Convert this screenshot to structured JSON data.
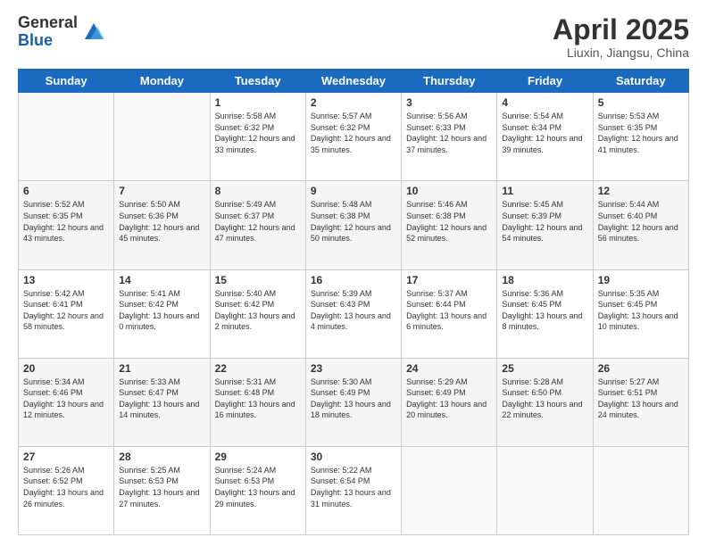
{
  "logo": {
    "general": "General",
    "blue": "Blue"
  },
  "header": {
    "title": "April 2025",
    "location": "Liuxin, Jiangsu, China"
  },
  "weekdays": [
    "Sunday",
    "Monday",
    "Tuesday",
    "Wednesday",
    "Thursday",
    "Friday",
    "Saturday"
  ],
  "weeks": [
    [
      {
        "day": "",
        "sunrise": "",
        "sunset": "",
        "daylight": ""
      },
      {
        "day": "",
        "sunrise": "",
        "sunset": "",
        "daylight": ""
      },
      {
        "day": "1",
        "sunrise": "Sunrise: 5:58 AM",
        "sunset": "Sunset: 6:32 PM",
        "daylight": "Daylight: 12 hours and 33 minutes."
      },
      {
        "day": "2",
        "sunrise": "Sunrise: 5:57 AM",
        "sunset": "Sunset: 6:32 PM",
        "daylight": "Daylight: 12 hours and 35 minutes."
      },
      {
        "day": "3",
        "sunrise": "Sunrise: 5:56 AM",
        "sunset": "Sunset: 6:33 PM",
        "daylight": "Daylight: 12 hours and 37 minutes."
      },
      {
        "day": "4",
        "sunrise": "Sunrise: 5:54 AM",
        "sunset": "Sunset: 6:34 PM",
        "daylight": "Daylight: 12 hours and 39 minutes."
      },
      {
        "day": "5",
        "sunrise": "Sunrise: 5:53 AM",
        "sunset": "Sunset: 6:35 PM",
        "daylight": "Daylight: 12 hours and 41 minutes."
      }
    ],
    [
      {
        "day": "6",
        "sunrise": "Sunrise: 5:52 AM",
        "sunset": "Sunset: 6:35 PM",
        "daylight": "Daylight: 12 hours and 43 minutes."
      },
      {
        "day": "7",
        "sunrise": "Sunrise: 5:50 AM",
        "sunset": "Sunset: 6:36 PM",
        "daylight": "Daylight: 12 hours and 45 minutes."
      },
      {
        "day": "8",
        "sunrise": "Sunrise: 5:49 AM",
        "sunset": "Sunset: 6:37 PM",
        "daylight": "Daylight: 12 hours and 47 minutes."
      },
      {
        "day": "9",
        "sunrise": "Sunrise: 5:48 AM",
        "sunset": "Sunset: 6:38 PM",
        "daylight": "Daylight: 12 hours and 50 minutes."
      },
      {
        "day": "10",
        "sunrise": "Sunrise: 5:46 AM",
        "sunset": "Sunset: 6:38 PM",
        "daylight": "Daylight: 12 hours and 52 minutes."
      },
      {
        "day": "11",
        "sunrise": "Sunrise: 5:45 AM",
        "sunset": "Sunset: 6:39 PM",
        "daylight": "Daylight: 12 hours and 54 minutes."
      },
      {
        "day": "12",
        "sunrise": "Sunrise: 5:44 AM",
        "sunset": "Sunset: 6:40 PM",
        "daylight": "Daylight: 12 hours and 56 minutes."
      }
    ],
    [
      {
        "day": "13",
        "sunrise": "Sunrise: 5:42 AM",
        "sunset": "Sunset: 6:41 PM",
        "daylight": "Daylight: 12 hours and 58 minutes."
      },
      {
        "day": "14",
        "sunrise": "Sunrise: 5:41 AM",
        "sunset": "Sunset: 6:42 PM",
        "daylight": "Daylight: 13 hours and 0 minutes."
      },
      {
        "day": "15",
        "sunrise": "Sunrise: 5:40 AM",
        "sunset": "Sunset: 6:42 PM",
        "daylight": "Daylight: 13 hours and 2 minutes."
      },
      {
        "day": "16",
        "sunrise": "Sunrise: 5:39 AM",
        "sunset": "Sunset: 6:43 PM",
        "daylight": "Daylight: 13 hours and 4 minutes."
      },
      {
        "day": "17",
        "sunrise": "Sunrise: 5:37 AM",
        "sunset": "Sunset: 6:44 PM",
        "daylight": "Daylight: 13 hours and 6 minutes."
      },
      {
        "day": "18",
        "sunrise": "Sunrise: 5:36 AM",
        "sunset": "Sunset: 6:45 PM",
        "daylight": "Daylight: 13 hours and 8 minutes."
      },
      {
        "day": "19",
        "sunrise": "Sunrise: 5:35 AM",
        "sunset": "Sunset: 6:45 PM",
        "daylight": "Daylight: 13 hours and 10 minutes."
      }
    ],
    [
      {
        "day": "20",
        "sunrise": "Sunrise: 5:34 AM",
        "sunset": "Sunset: 6:46 PM",
        "daylight": "Daylight: 13 hours and 12 minutes."
      },
      {
        "day": "21",
        "sunrise": "Sunrise: 5:33 AM",
        "sunset": "Sunset: 6:47 PM",
        "daylight": "Daylight: 13 hours and 14 minutes."
      },
      {
        "day": "22",
        "sunrise": "Sunrise: 5:31 AM",
        "sunset": "Sunset: 6:48 PM",
        "daylight": "Daylight: 13 hours and 16 minutes."
      },
      {
        "day": "23",
        "sunrise": "Sunrise: 5:30 AM",
        "sunset": "Sunset: 6:49 PM",
        "daylight": "Daylight: 13 hours and 18 minutes."
      },
      {
        "day": "24",
        "sunrise": "Sunrise: 5:29 AM",
        "sunset": "Sunset: 6:49 PM",
        "daylight": "Daylight: 13 hours and 20 minutes."
      },
      {
        "day": "25",
        "sunrise": "Sunrise: 5:28 AM",
        "sunset": "Sunset: 6:50 PM",
        "daylight": "Daylight: 13 hours and 22 minutes."
      },
      {
        "day": "26",
        "sunrise": "Sunrise: 5:27 AM",
        "sunset": "Sunset: 6:51 PM",
        "daylight": "Daylight: 13 hours and 24 minutes."
      }
    ],
    [
      {
        "day": "27",
        "sunrise": "Sunrise: 5:26 AM",
        "sunset": "Sunset: 6:52 PM",
        "daylight": "Daylight: 13 hours and 26 minutes."
      },
      {
        "day": "28",
        "sunrise": "Sunrise: 5:25 AM",
        "sunset": "Sunset: 6:53 PM",
        "daylight": "Daylight: 13 hours and 27 minutes."
      },
      {
        "day": "29",
        "sunrise": "Sunrise: 5:24 AM",
        "sunset": "Sunset: 6:53 PM",
        "daylight": "Daylight: 13 hours and 29 minutes."
      },
      {
        "day": "30",
        "sunrise": "Sunrise: 5:22 AM",
        "sunset": "Sunset: 6:54 PM",
        "daylight": "Daylight: 13 hours and 31 minutes."
      },
      {
        "day": "",
        "sunrise": "",
        "sunset": "",
        "daylight": ""
      },
      {
        "day": "",
        "sunrise": "",
        "sunset": "",
        "daylight": ""
      },
      {
        "day": "",
        "sunrise": "",
        "sunset": "",
        "daylight": ""
      }
    ]
  ]
}
